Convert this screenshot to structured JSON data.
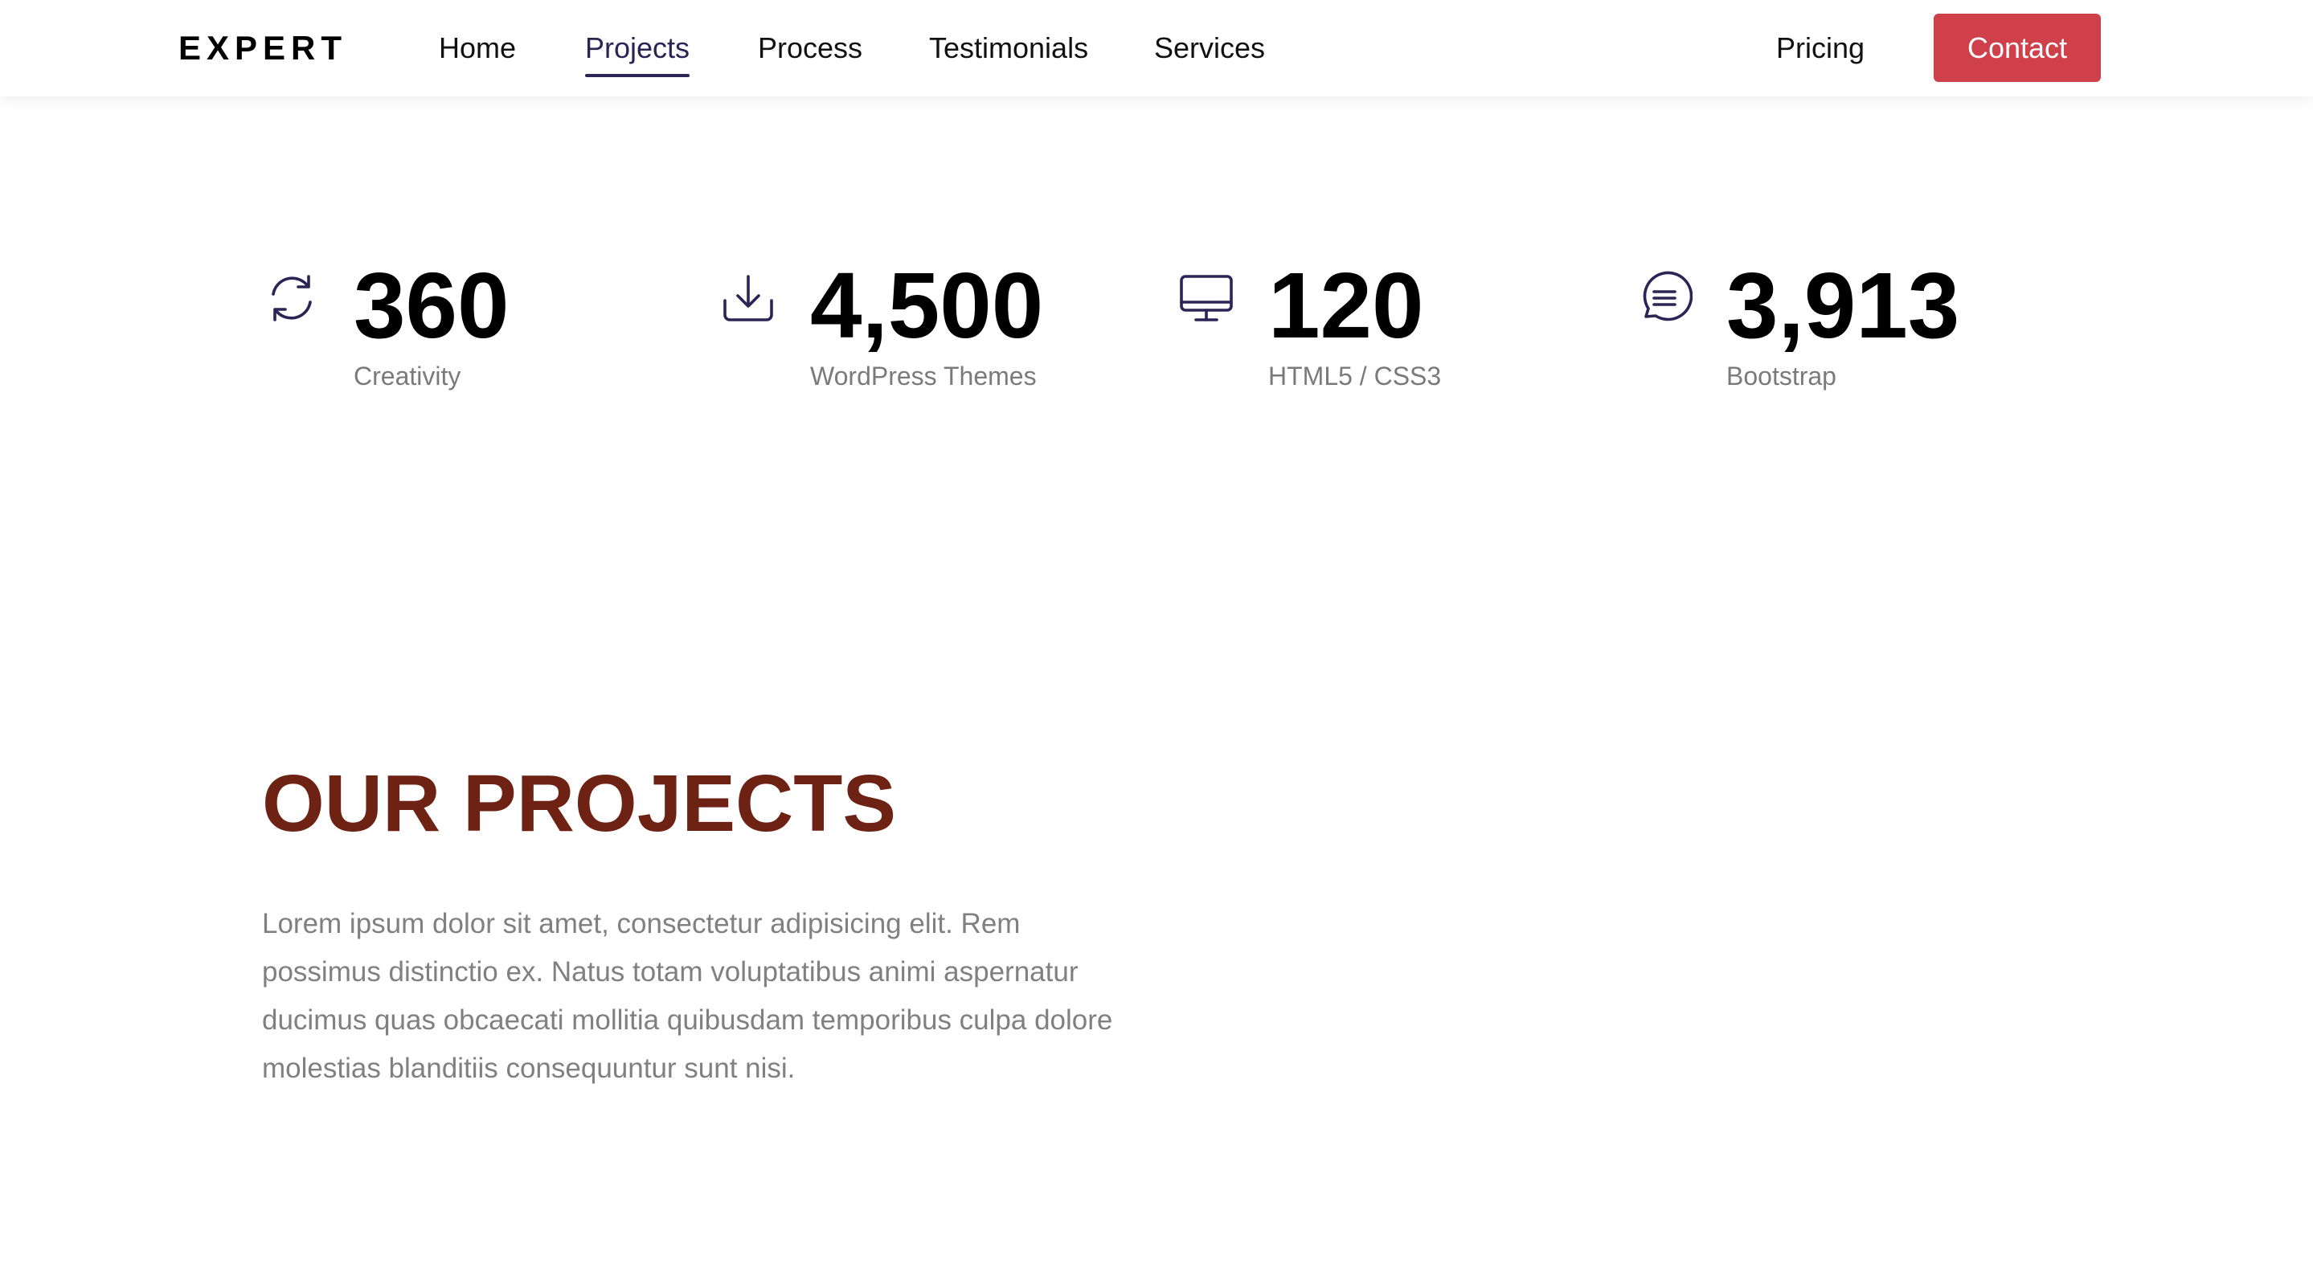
{
  "navbar": {
    "brand": "EXPERT",
    "links": [
      {
        "label": "Home",
        "active": false
      },
      {
        "label": "Projects",
        "active": true
      },
      {
        "label": "Process",
        "active": false
      },
      {
        "label": "Testimonials",
        "active": false
      },
      {
        "label": "Services",
        "active": false
      }
    ],
    "pricing_label": "Pricing",
    "contact_label": "Contact",
    "accent_color": "#2b2455",
    "contact_color": "#d0404a"
  },
  "stats": [
    {
      "icon": "refresh-icon",
      "value": "360",
      "label": "Creativity"
    },
    {
      "icon": "download-icon",
      "value": "4,500",
      "label": "WordPress Themes"
    },
    {
      "icon": "monitor-icon",
      "value": "120",
      "label": "HTML5 / CSS3"
    },
    {
      "icon": "chat-icon",
      "value": "3,913",
      "label": "Bootstrap"
    }
  ],
  "projects": {
    "title": "OUR PROJECTS",
    "description": "Lorem ipsum dolor sit amet, consectetur adipisicing elit. Rem possimus distinctio ex. Natus totam voluptatibus animi aspernatur ducimus quas obcaecati mollitia quibusdam temporibus culpa dolore molestias blanditiis consequuntur sunt nisi.",
    "title_color": "#6e2214"
  }
}
